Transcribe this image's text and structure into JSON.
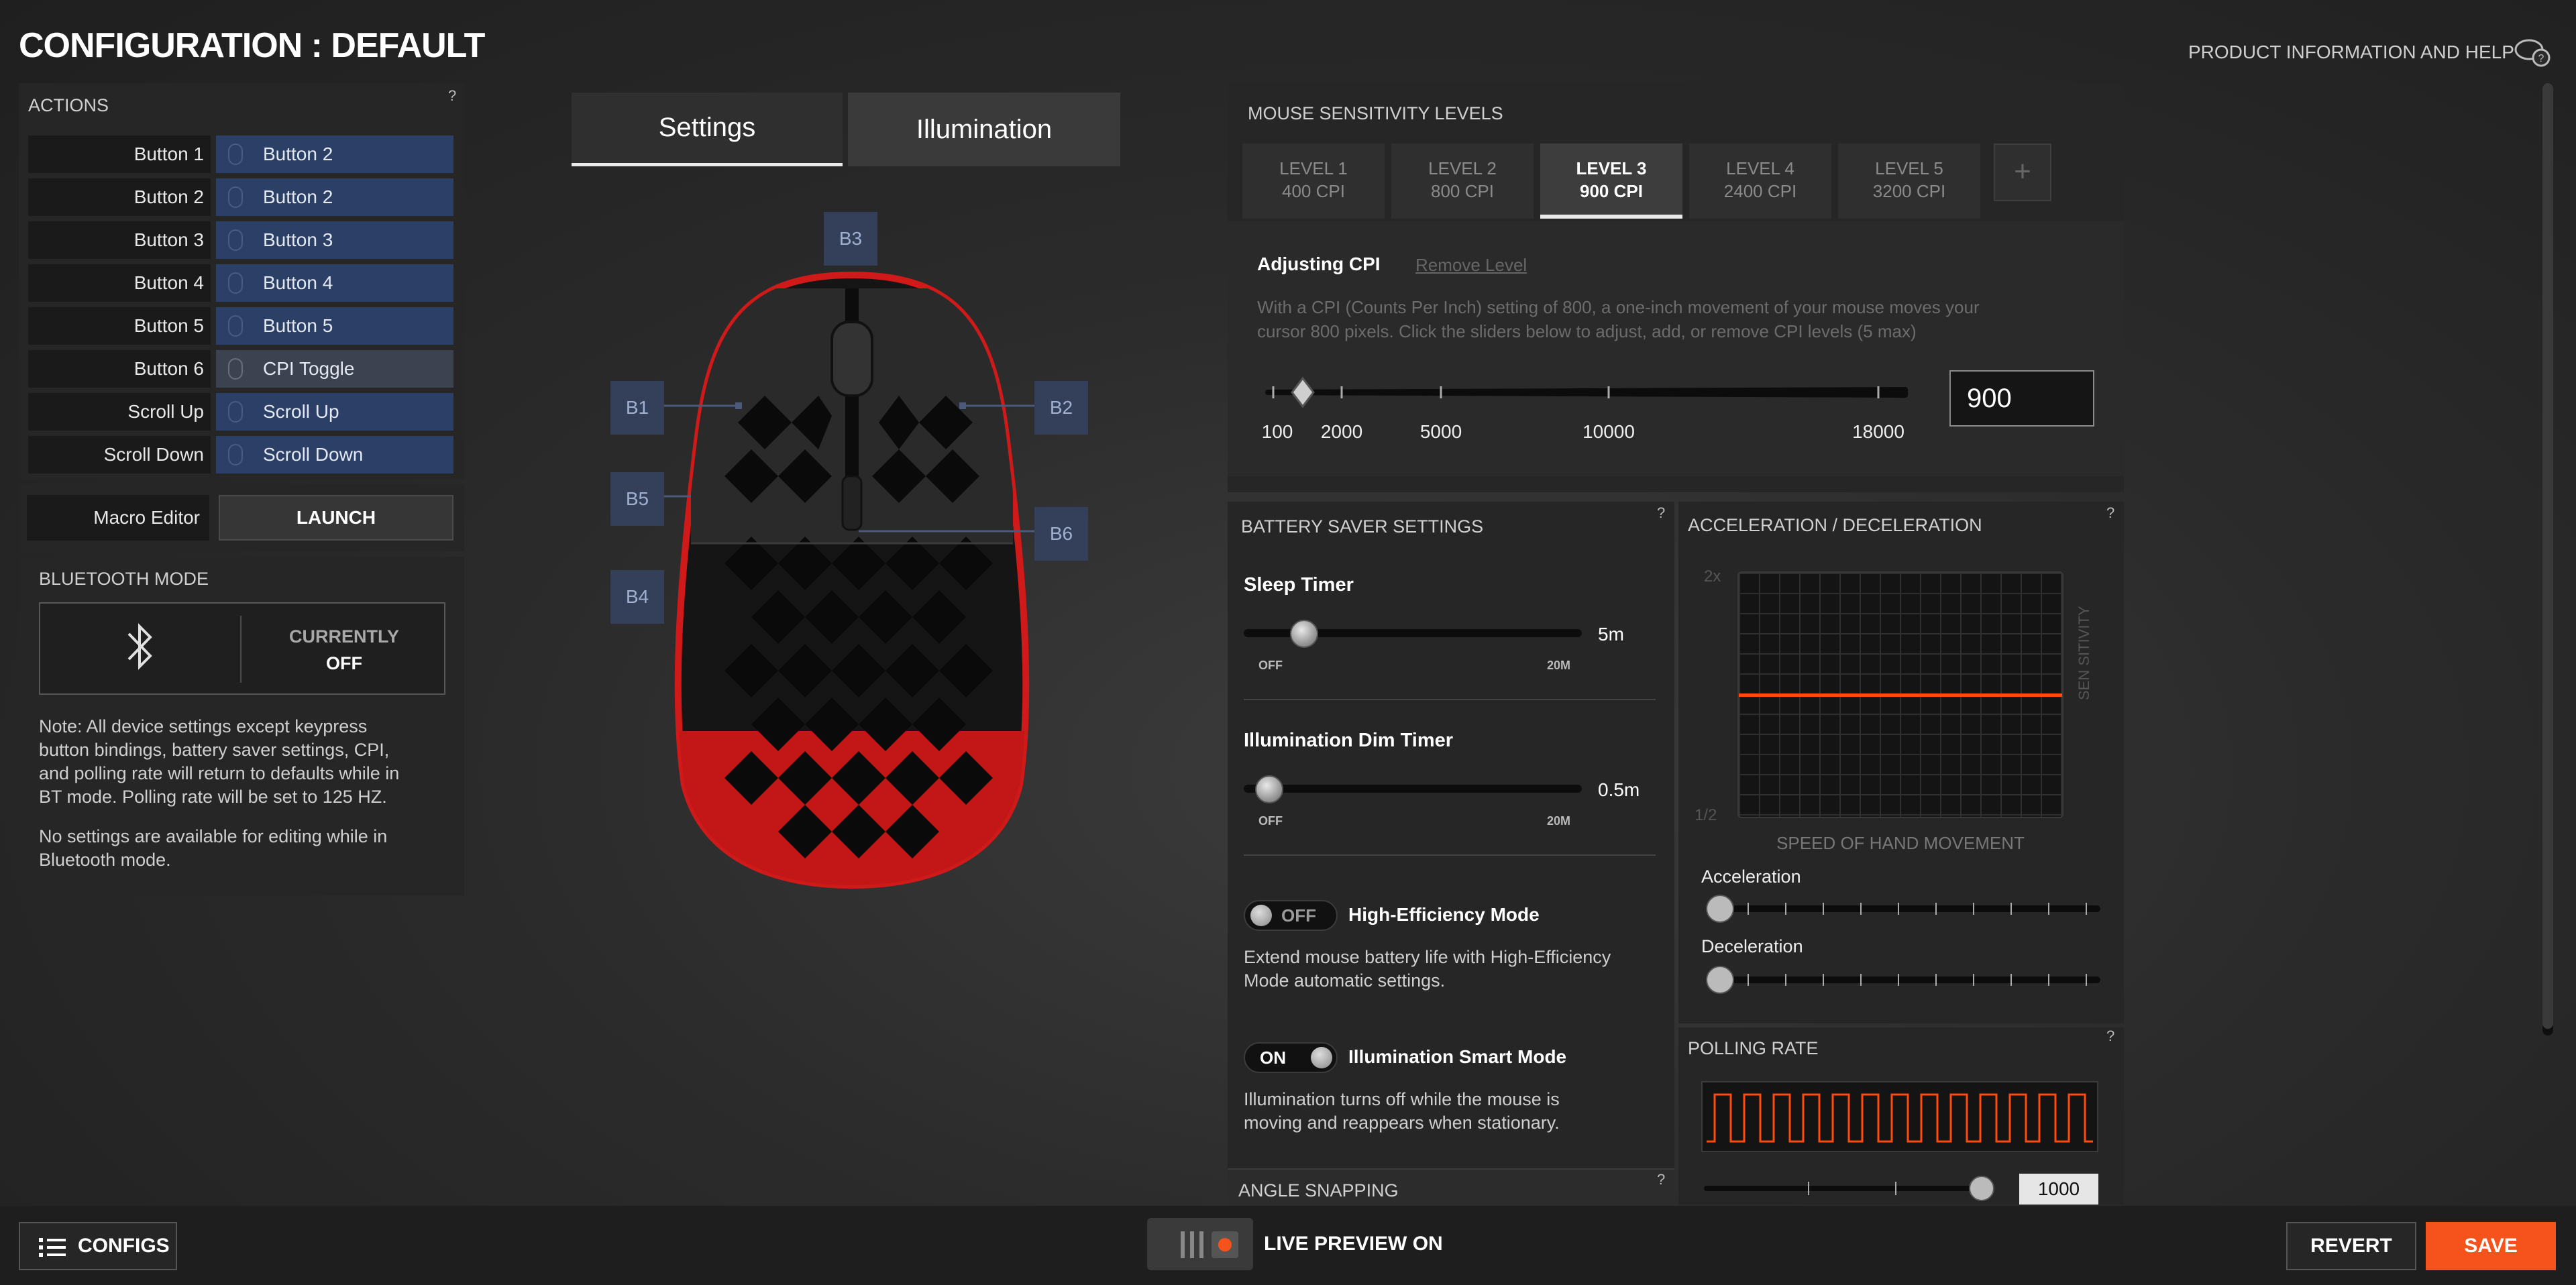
{
  "header": {
    "title": "CONFIGURATION : DEFAULT",
    "help_link": "PRODUCT INFORMATION AND HELP"
  },
  "actions": {
    "title": "ACTIONS",
    "help": "?",
    "rows": [
      {
        "name": "Button 1",
        "value": "Button 2"
      },
      {
        "name": "Button 2",
        "value": "Button 2"
      },
      {
        "name": "Button 3",
        "value": "Button 3"
      },
      {
        "name": "Button 4",
        "value": "Button 4"
      },
      {
        "name": "Button 5",
        "value": "Button 5"
      },
      {
        "name": "Button 6",
        "value": "CPI Toggle"
      },
      {
        "name": "Scroll Up",
        "value": "Scroll Up"
      },
      {
        "name": "Scroll Down",
        "value": "Scroll Down"
      }
    ],
    "macro_label": "Macro Editor",
    "launch_label": "LAUNCH"
  },
  "bluetooth": {
    "title": "BLUETOOTH MODE",
    "currently": "CURRENTLY",
    "state": "OFF",
    "note1_lines": [
      "Note: All device settings except keypress",
      "button bindings, battery saver settings, CPI,",
      "and polling rate will return to defaults while in",
      "BT mode. Polling rate will be set to 125 HZ."
    ],
    "note2_lines": [
      "No settings are available for editing while in",
      "Bluetooth mode."
    ]
  },
  "tabs": {
    "settings": "Settings",
    "illumination": "Illumination"
  },
  "mouse_tags": [
    "B1",
    "B2",
    "B3",
    "B4",
    "B5",
    "B6"
  ],
  "sensitivity": {
    "title": "MOUSE SENSITIVITY LEVELS",
    "levels": [
      {
        "name": "LEVEL 1",
        "cpi": "400 CPI"
      },
      {
        "name": "LEVEL 2",
        "cpi": "800 CPI"
      },
      {
        "name": "LEVEL 3",
        "cpi": "900 CPI"
      },
      {
        "name": "LEVEL 4",
        "cpi": "2400 CPI"
      },
      {
        "name": "LEVEL 5",
        "cpi": "3200 CPI"
      }
    ],
    "active_level": 3,
    "add": "+",
    "adjusting": "Adjusting CPI",
    "remove": "Remove Level",
    "desc_lines": [
      "With a CPI (Counts Per Inch) setting of 800, a one-inch movement of your mouse moves your",
      "cursor 800 pixels. Click the sliders below to adjust, add, or remove CPI levels (5 max)"
    ],
    "ticks": [
      "100",
      "2000",
      "5000",
      "10000",
      "18000"
    ],
    "value": "900"
  },
  "battery": {
    "title": "BATTERY SAVER SETTINGS",
    "help": "?",
    "sleep_label": "Sleep Timer",
    "sleep_value": "5m",
    "sleep_level": 0.15,
    "illum_label": "Illumination Dim Timer",
    "illum_value": "0.5m",
    "illum_level": 0.02,
    "off": "OFF",
    "max": "20M",
    "he_toggle": "OFF",
    "he_title": "High-Efficiency Mode",
    "he_desc_lines": [
      "Extend mouse battery life with High-Efficiency",
      "Mode automatic settings."
    ],
    "ism_toggle": "ON",
    "ism_title": "Illumination Smart Mode",
    "ism_desc_lines": [
      "Illumination turns off while the mouse is",
      "moving and reappears when stationary."
    ],
    "angle_title": "ANGLE SNAPPING"
  },
  "accel": {
    "title": "ACCELERATION / DECELERATION",
    "help": "?",
    "y_top": "2x",
    "y_bottom": "1/2",
    "side_label": "SEN SITIVITY",
    "x_label": "SPEED OF HAND MOVEMENT",
    "acc_label": "Acceleration",
    "dec_label": "Deceleration",
    "line_color": "#ff4b0d"
  },
  "polling": {
    "title": "POLLING RATE",
    "help": "?",
    "value": "1000"
  },
  "bottom": {
    "configs": "CONFIGS",
    "live_preview": "LIVE PREVIEW ON",
    "revert": "REVERT",
    "save": "SAVE",
    "accent": "#f5531b"
  }
}
